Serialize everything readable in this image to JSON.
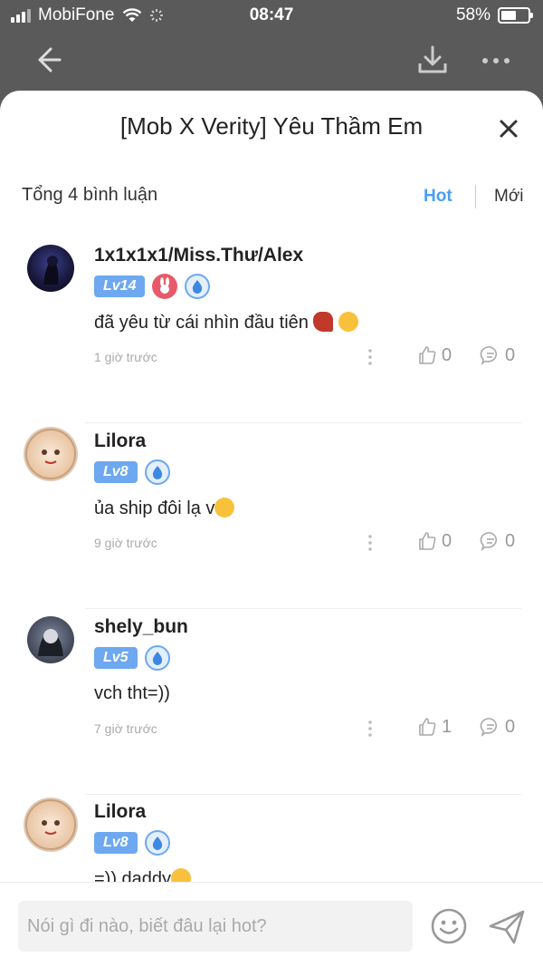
{
  "status": {
    "carrier": "MobiFone",
    "time": "08:47",
    "battery": "58%",
    "battery_level": 0.58
  },
  "sheet": {
    "title": "[Mob X Verity] Yêu Thầm Em"
  },
  "comments_header": {
    "total": "Tổng 4 bình luận",
    "sort_hot": "Hot",
    "sort_new": "Mới"
  },
  "comments": [
    {
      "user": "1x1x1x1/Miss.Thư/Alex",
      "level": "Lv14",
      "text": "đã yêu từ cái nhìn đầu tiên",
      "time": "1 giờ trước",
      "likes": "0",
      "replies": "0"
    },
    {
      "user": "Lilora",
      "level": "Lv8",
      "text": "ủa ship đôi lạ v",
      "time": "9 giờ trước",
      "likes": "0",
      "replies": "0"
    },
    {
      "user": "shely_bun",
      "level": "Lv5",
      "text": "vch tht=))",
      "time": "7 giờ trước",
      "likes": "1",
      "replies": "0"
    },
    {
      "user": "Lilora",
      "level": "Lv8",
      "text": "=)) daddy",
      "time": "",
      "likes": "",
      "replies": ""
    }
  ],
  "composer": {
    "placeholder": "Nói gì đi nào, biết đâu lại hot?"
  },
  "colors": {
    "accent": "#4a9ff2",
    "level_badge": "#6da8f0",
    "backdrop": "#5a5a5a"
  }
}
